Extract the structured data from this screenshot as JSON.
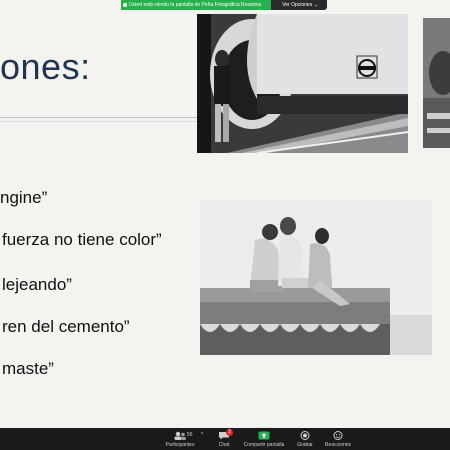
{
  "slide": {
    "title": "ones:",
    "bullets": [
      "ngine”",
      "fuerza no tiene color”",
      "lejeando”",
      "ren del cemento”",
      "maste”"
    ]
  },
  "share_banner": {
    "message": "Usted está viendo la pantalla de Peña Fotográfica Rosarina",
    "options_label": "Ver Opciones",
    "options_caret": "⌄"
  },
  "toolbar": {
    "participants": {
      "label": "Participantes",
      "count": "56",
      "caret": "^"
    },
    "chat": {
      "label": "Chat",
      "badge": "2"
    },
    "share": {
      "label": "Compartir pantalla"
    },
    "record": {
      "label": "Grabar"
    },
    "reactions": {
      "label": "Reacciones"
    }
  },
  "colors": {
    "slide_background": "#f4f3ef",
    "title": "#1f3550",
    "share_green": "#27b04d",
    "toolbar": "#1a1a1a",
    "badge_red": "#e02828"
  },
  "icons": [
    "participants-icon",
    "chat-icon",
    "share-screen-icon",
    "record-icon",
    "reactions-icon",
    "caret-icon"
  ]
}
